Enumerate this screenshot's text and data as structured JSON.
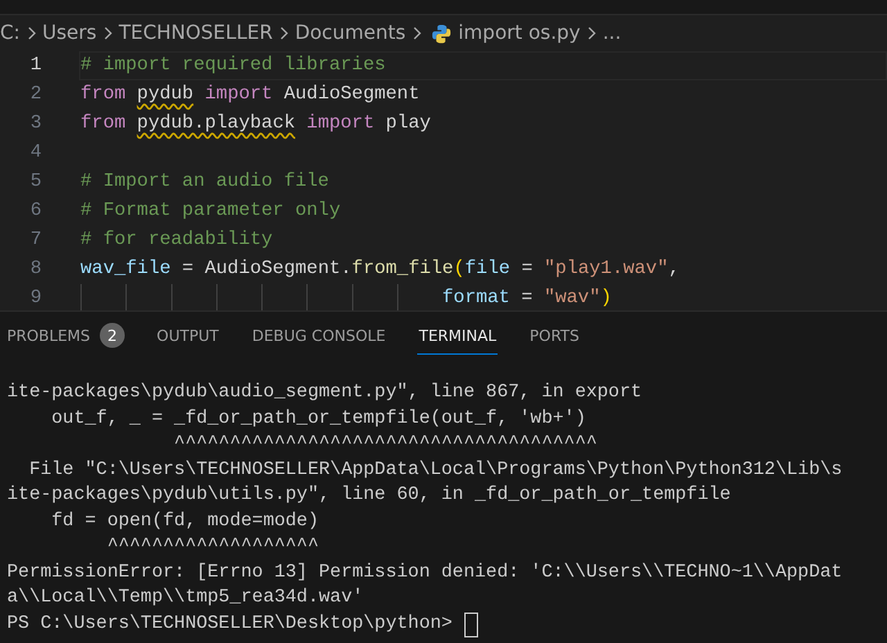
{
  "breadcrumb": [
    {
      "text": "C:",
      "kind": "folder"
    },
    {
      "text": "Users",
      "kind": "folder"
    },
    {
      "text": "TECHNOSELLER",
      "kind": "folder"
    },
    {
      "text": "Documents",
      "kind": "folder"
    },
    {
      "text": "import os.py",
      "kind": "python-file"
    },
    {
      "text": "...",
      "kind": "more"
    }
  ],
  "editor": {
    "lines": [
      {
        "number": "1",
        "current": true,
        "tokens": [
          {
            "text": "# import required libraries",
            "kind": "comment"
          }
        ]
      },
      {
        "number": "2",
        "current": false,
        "tokens": [
          {
            "text": "from ",
            "kind": "keyword"
          },
          {
            "text": "pydub",
            "kind": "plain",
            "warning": true
          },
          {
            "text": " import",
            "kind": "keyword"
          },
          {
            "text": " AudioSegment",
            "kind": "plain"
          }
        ]
      },
      {
        "number": "3",
        "current": false,
        "tokens": [
          {
            "text": "from ",
            "kind": "keyword"
          },
          {
            "text": "pydub.playback",
            "kind": "plain",
            "warning": true
          },
          {
            "text": " import",
            "kind": "keyword"
          },
          {
            "text": " play",
            "kind": "plain"
          }
        ]
      },
      {
        "number": "4",
        "current": false
      },
      {
        "number": "5",
        "current": false,
        "tokens": [
          {
            "text": "# Import an audio file",
            "kind": "comment"
          }
        ]
      },
      {
        "number": "6",
        "current": false,
        "tokens": [
          {
            "text": "# Format parameter only",
            "kind": "comment"
          }
        ]
      },
      {
        "number": "7",
        "current": false,
        "tokens": [
          {
            "text": "# for readability",
            "kind": "comment"
          }
        ]
      },
      {
        "number": "8",
        "current": false,
        "tokens": [
          {
            "text": "wav_file",
            "kind": "variable"
          },
          {
            "text": " = AudioSegment.",
            "kind": "plain"
          },
          {
            "text": "from_file",
            "kind": "function"
          },
          {
            "text": "(",
            "kind": "bracket"
          },
          {
            "text": "file",
            "kind": "variable"
          },
          {
            "text": " = ",
            "kind": "plain"
          },
          {
            "text": "\"play1.wav\"",
            "kind": "string"
          },
          {
            "text": ",",
            "kind": "plain"
          }
        ]
      },
      {
        "number": "9",
        "current": false,
        "continuation": true,
        "tokens": [
          {
            "text": "format",
            "kind": "variable"
          },
          {
            "text": " = ",
            "kind": "plain"
          },
          {
            "text": "\"wav\"",
            "kind": "string"
          },
          {
            "text": ")",
            "kind": "bracket"
          }
        ]
      }
    ]
  },
  "panel_tabs": [
    {
      "label": "PROBLEMS",
      "badge": "2",
      "selected": false
    },
    {
      "label": "OUTPUT",
      "selected": false
    },
    {
      "label": "DEBUG CONSOLE",
      "selected": false
    },
    {
      "label": "TERMINAL",
      "selected": true
    },
    {
      "label": "PORTS",
      "selected": false
    }
  ],
  "terminal": {
    "lines": [
      "ite-packages\\pydub\\audio_segment.py\", line 867, in export",
      "    out_f, _ = _fd_or_path_or_tempfile(out_f, 'wb+')",
      "               ^^^^^^^^^^^^^^^^^^^^^^^^^^^^^^^^^^^^^^",
      "  File \"C:\\Users\\TECHNOSELLER\\AppData\\Local\\Programs\\Python\\Python312\\Lib\\s",
      "ite-packages\\pydub\\utils.py\", line 60, in _fd_or_path_or_tempfile",
      "    fd = open(fd, mode=mode)",
      "         ^^^^^^^^^^^^^^^^^^^",
      "PermissionError: [Errno 13] Permission denied: 'C:\\\\Users\\\\TECHNO~1\\\\AppDat",
      "a\\\\Local\\\\Temp\\\\tmp5_rea34d.wav'"
    ],
    "prompt": "PS C:\\Users\\TECHNOSELLER\\Desktop\\python> "
  }
}
